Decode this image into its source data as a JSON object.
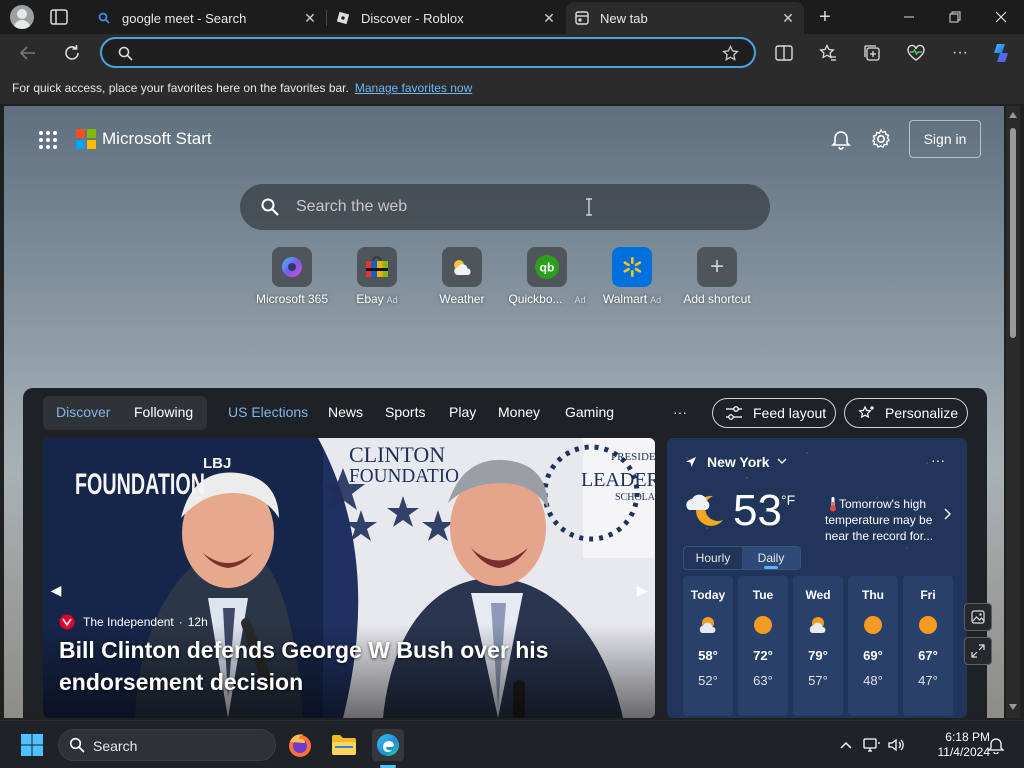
{
  "tabs": [
    {
      "title": "google meet - Search",
      "active": false
    },
    {
      "title": "Discover - Roblox",
      "active": false
    },
    {
      "title": "New tab",
      "active": true
    }
  ],
  "address": {
    "value": "",
    "placeholder": ""
  },
  "favorites_bar": {
    "message": "For quick access, place your favorites here on the favorites bar.",
    "link": "Manage favorites now"
  },
  "header": {
    "brand": "Microsoft Start",
    "sign_in": "Sign in"
  },
  "search": {
    "placeholder": "Search the web"
  },
  "shortcuts": [
    {
      "label": "Microsoft 365",
      "ad": ""
    },
    {
      "label": "Ebay",
      "ad": "Ad"
    },
    {
      "label": "Weather",
      "ad": ""
    },
    {
      "label": "Quickbo...",
      "ad": "Ad"
    },
    {
      "label": "Walmart",
      "ad": "Ad"
    },
    {
      "label": "Add shortcut",
      "ad": ""
    }
  ],
  "feed": {
    "tabs": {
      "discover": "Discover",
      "following": "Following",
      "us_elections": "US Elections",
      "news": "News",
      "sports": "Sports",
      "play": "Play",
      "money": "Money",
      "gaming": "Gaming",
      "more": "···"
    },
    "feed_layout": "Feed layout",
    "personalize": "Personalize"
  },
  "hero": {
    "source": "The Independent",
    "age": "12h",
    "headline": "Bill Clinton defends George W Bush over his endorsement decision",
    "backdrop_text": {
      "lbj": "LBJ",
      "foundation": "FOUNDATION",
      "clinton": "CLINTON",
      "clinton_foundation": "FOUNDATIO",
      "presiden": "PRESIDEN",
      "leader": "LEADER",
      "schola": "SCHOLA"
    }
  },
  "weather": {
    "location": "New York",
    "temp": "53",
    "unit": "°F",
    "alert": "Tomorrow's high temperature may be near the record for...",
    "tabs": [
      "Hourly",
      "Daily"
    ],
    "selected_tab": "Daily",
    "days": [
      {
        "day": "Today",
        "icon": "partly-cloudy-icon",
        "hi": "58°",
        "lo": "52°"
      },
      {
        "day": "Tue",
        "icon": "sun-icon",
        "hi": "72°",
        "lo": "63°"
      },
      {
        "day": "Wed",
        "icon": "partly-cloudy-icon",
        "hi": "79°",
        "lo": "57°"
      },
      {
        "day": "Thu",
        "icon": "sun-icon",
        "hi": "69°",
        "lo": "48°"
      },
      {
        "day": "Fri",
        "icon": "sun-icon",
        "hi": "67°",
        "lo": "47°"
      }
    ]
  },
  "taskbar": {
    "search_label": "Search",
    "time": "6:18 PM",
    "date": "11/4/2024"
  },
  "colors": {
    "accent": "#4aa3df",
    "link": "#6cb8f5",
    "sun": "#f59a23"
  }
}
